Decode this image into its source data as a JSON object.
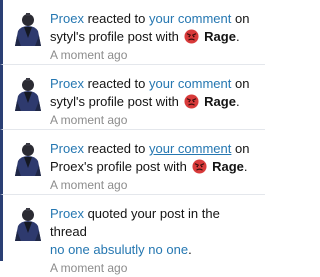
{
  "alerts": [
    {
      "user": "Proex",
      "t1": " reacted to ",
      "link": "your comment",
      "t2": " on",
      "l2": "sytyl's profile post with ",
      "reaction": "Rage",
      "end": ".",
      "time": "A moment ago"
    },
    {
      "user": "Proex",
      "t1": " reacted to ",
      "link": "your comment",
      "t2": " on",
      "l2": "sytyl's profile post with ",
      "reaction": "Rage",
      "end": ".",
      "time": "A moment ago"
    },
    {
      "user": "Proex",
      "t1": " reacted to ",
      "link": "your comment",
      "t2": " on",
      "l2": "Proex's profile post with ",
      "reaction": "Rage",
      "end": ".",
      "time": "A moment ago"
    },
    {
      "user": "Proex",
      "t1": " quoted your post in the thread",
      "thread": "no one absulutly no one",
      "end": ".",
      "time": "A moment ago"
    }
  ],
  "icons": {
    "avatar": "avatar-icon",
    "reaction": "rage-icon"
  },
  "colors": {
    "link": "#2577b1",
    "accent_bar": "#2a3f74",
    "muted": "#8c8c8c",
    "rage": "#d83a3a"
  }
}
